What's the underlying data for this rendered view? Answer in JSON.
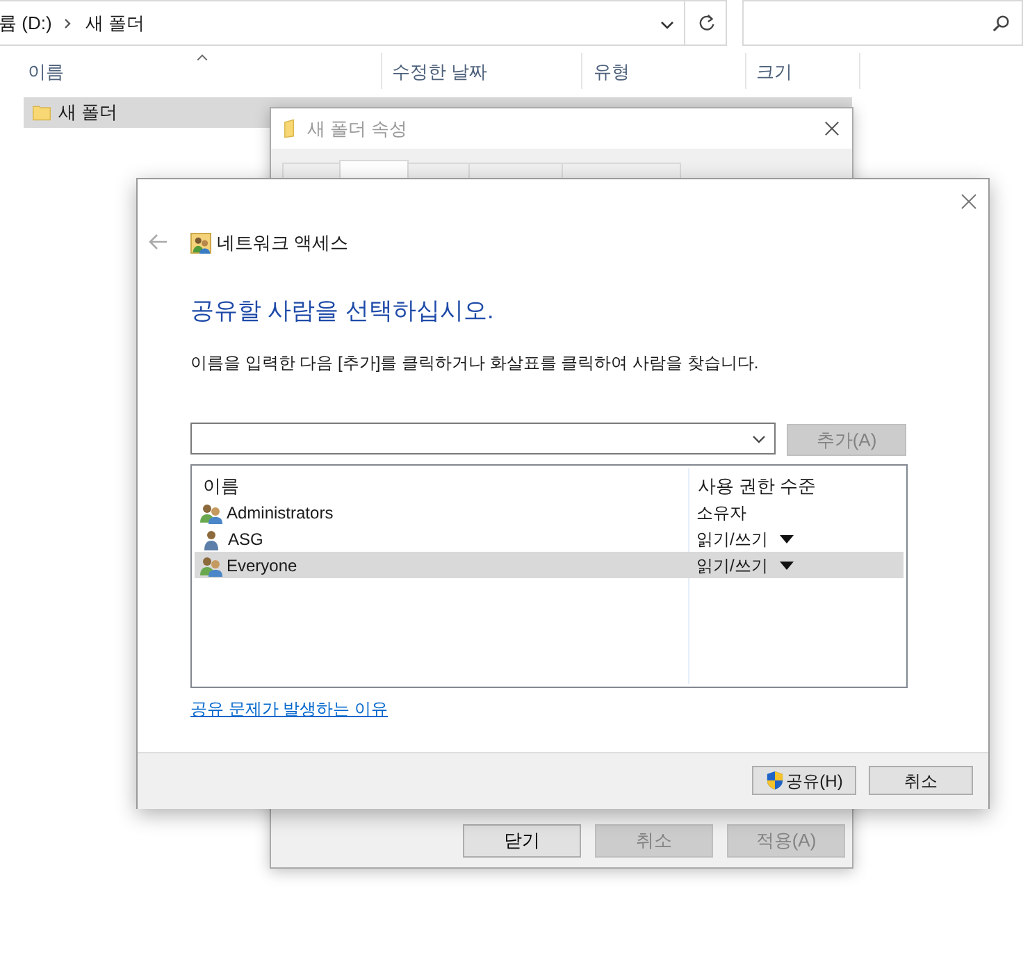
{
  "explorer": {
    "address": {
      "path": [
        "륨 (D:)",
        "새 폴더"
      ]
    },
    "columns": [
      "이름",
      "수정한 날짜",
      "유형",
      "크기"
    ],
    "files": [
      {
        "name": "새 폴더",
        "selected": true
      }
    ]
  },
  "properties": {
    "title": "새 폴더 속성",
    "active": false,
    "tabs": [
      {
        "selected": false
      },
      {
        "selected": true
      },
      {
        "selected": false
      },
      {
        "selected": false
      },
      {
        "selected": false
      }
    ],
    "buttons": [
      {
        "label": "닫기",
        "disabled": false
      },
      {
        "label": "취소",
        "disabled": true
      },
      {
        "label": "적용(A)",
        "disabled": true
      }
    ]
  },
  "share": {
    "title": "네트워크 액세스",
    "heading": "공유할 사람을 선택하십시오.",
    "instruction": "이름을 입력한 다음 [추가]를 클릭하거나 화살표를 클릭하여 사람을 찾습니다.",
    "add_button": {
      "label": "추가(A)",
      "disabled": true
    },
    "columns": [
      "이름",
      "사용 권한 수준"
    ],
    "entries": [
      {
        "name": "Administrators",
        "kind": "group",
        "permission": "소유자",
        "editable": false,
        "selected": false
      },
      {
        "name": "ASG",
        "kind": "user",
        "permission": "읽기/쓰기",
        "editable": true,
        "selected": false
      },
      {
        "name": "Everyone",
        "kind": "group",
        "permission": "읽기/쓰기",
        "editable": true,
        "selected": true
      }
    ],
    "link": "공유 문제가 발생하는 이유",
    "buttons": [
      {
        "label": "공유(H)",
        "kind": "shield"
      },
      {
        "label": "취소",
        "kind": "plain"
      }
    ]
  }
}
